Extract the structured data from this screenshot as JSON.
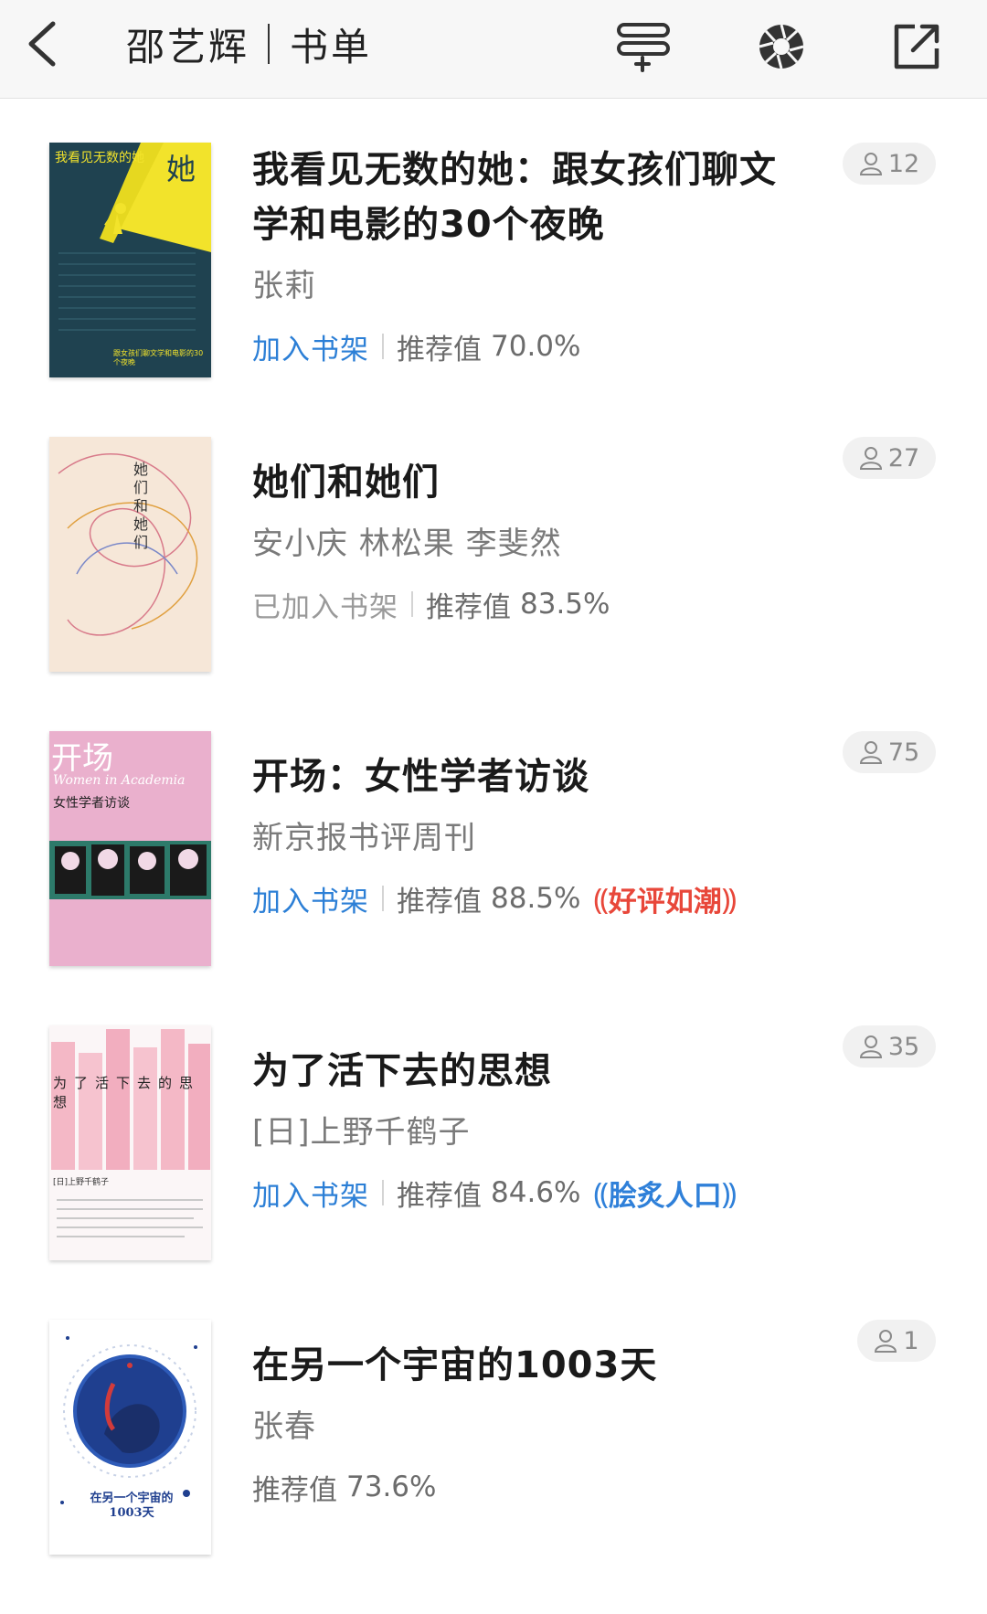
{
  "header": {
    "title_name": "邵艺辉",
    "title_suffix": "书单",
    "back_icon": "back-chevron-icon",
    "add_icon": "add-list-icon",
    "camera_icon": "aperture-icon",
    "share_icon": "share-external-icon"
  },
  "books": [
    {
      "title": "我看见无数的她：跟女孩们聊文学和电影的30个夜晚",
      "author": "张莉",
      "shelf_label": "加入书架",
      "shelf_state": "add",
      "rec_label": "推荐值",
      "rec_value": "70.0%",
      "readers": "12",
      "cover_text": "我看见无数的她",
      "cover_big": "她",
      "cover_sub": "跟女孩们聊文学和电影的30个夜晚"
    },
    {
      "title": "她们和她们",
      "author": "安小庆 林松果 李斐然",
      "shelf_label": "已加入书架",
      "shelf_state": "added",
      "rec_label": "推荐值",
      "rec_value": "83.5%",
      "readers": "27",
      "cover_text": "她们和她们"
    },
    {
      "title": "开场：女性学者访谈",
      "author": "新京报书评周刊",
      "shelf_label": "加入书架",
      "shelf_state": "add",
      "rec_label": "推荐值",
      "rec_value": "88.5%",
      "badge": "好评如潮",
      "badge_color": "#e8473a",
      "readers": "75",
      "cover_text": "女性学者访谈",
      "cover_big": "开场",
      "cover_en": "Women in Academia"
    },
    {
      "title": "为了活下去的思想",
      "author": "[日]上野千鹤子",
      "shelf_label": "加入书架",
      "shelf_state": "add",
      "rec_label": "推荐值",
      "rec_value": "84.6%",
      "badge": "脍炙人口",
      "badge_color": "#2f80d9",
      "readers": "35",
      "cover_text": "为了活下去的思想",
      "cover_author": "[日]上野千鹤子"
    },
    {
      "title": "在另一个宇宙的1003天",
      "author": "张春",
      "rec_label": "推荐值",
      "rec_value": "73.6%",
      "readers": "1",
      "cover_text": "在另一个宇宙的1003天"
    }
  ],
  "colors": {
    "link_blue": "#2c7fd6",
    "muted_gray": "#9a9a9a",
    "badge_red": "#e8473a",
    "badge_blue": "#2f80d9"
  }
}
